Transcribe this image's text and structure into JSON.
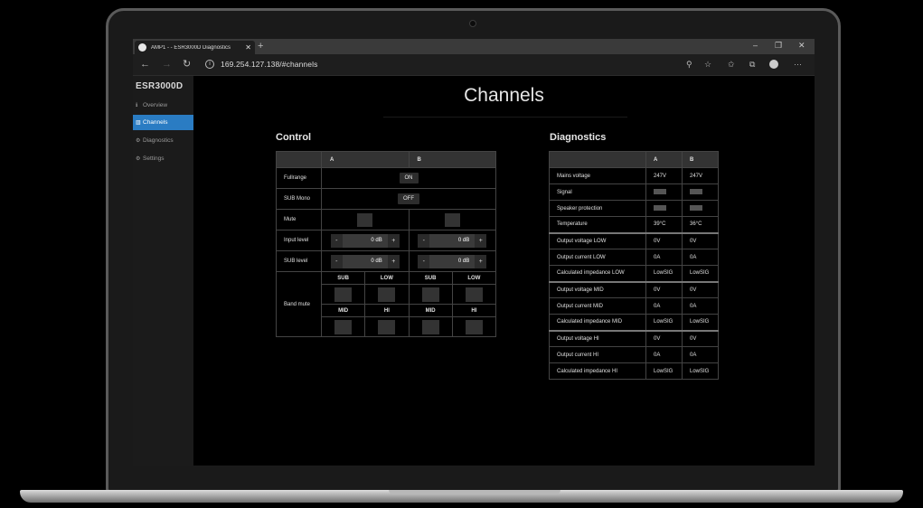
{
  "browser": {
    "tab_title": "AMP1 - - ESR3000D Diagnostics",
    "tab_close": "✕",
    "new_tab": "+",
    "url": "169.254.127.138/#channels",
    "win_minimize": "–",
    "win_restore": "❐",
    "win_close": "✕",
    "back_glyph": "←",
    "forward_glyph": "→",
    "reload_glyph": "↻",
    "info_glyph": "i",
    "zoom_glyph": "⚲",
    "favorite_glyph": "☆",
    "favorites_glyph": "✩",
    "collections_glyph": "⧉",
    "more_glyph": "···"
  },
  "sidebar": {
    "brand": "ESR3000D",
    "items": [
      {
        "icon": "ℹ",
        "label": "Overview"
      },
      {
        "icon": "▥",
        "label": "Channels"
      },
      {
        "icon": "⚙",
        "label": "Diagnostics"
      },
      {
        "icon": "⚙",
        "label": "Settings"
      }
    ]
  },
  "main": {
    "title": "Channels"
  },
  "control": {
    "title": "Control",
    "col_a": "A",
    "col_b": "B",
    "fullrange_label": "Fullrange",
    "fullrange_value": "ON",
    "sub_mono_label": "SUB Mono",
    "sub_mono_value": "OFF",
    "mute_label": "Mute",
    "input_level_label": "Input level",
    "input_level_a": "0 dB",
    "input_level_b": "0 dB",
    "sub_level_label": "SUB level",
    "sub_level_a": "0 dB",
    "sub_level_b": "0 dB",
    "minus": "-",
    "plus": "+",
    "band_mute_label": "Band mute",
    "bands": [
      "SUB",
      "LOW",
      "MID",
      "HI"
    ]
  },
  "diagnostics": {
    "title": "Diagnostics",
    "col_a": "A",
    "col_b": "B",
    "rows": [
      {
        "label": "Mains voltage",
        "a": "247V",
        "b": "247V"
      },
      {
        "label": "Signal",
        "a": "",
        "b": ""
      },
      {
        "label": "Speaker protection",
        "a": "",
        "b": ""
      },
      {
        "label": "Temperature",
        "a": "39°C",
        "b": "36°C"
      },
      {
        "label": "Output voltage LOW",
        "a": "0V",
        "b": "0V"
      },
      {
        "label": "Output current LOW",
        "a": "0A",
        "b": "0A"
      },
      {
        "label": "Calculated impedance LOW",
        "a": "LowSIG",
        "b": "LowSIG"
      },
      {
        "label": "Output voltage MID",
        "a": "0V",
        "b": "0V"
      },
      {
        "label": "Output current MID",
        "a": "0A",
        "b": "0A"
      },
      {
        "label": "Calculated impedance MID",
        "a": "LowSIG",
        "b": "LowSIG"
      },
      {
        "label": "Output voltage HI",
        "a": "0V",
        "b": "0V"
      },
      {
        "label": "Output current HI",
        "a": "0A",
        "b": "0A"
      },
      {
        "label": "Calculated impedance HI",
        "a": "LowSIG",
        "b": "LowSIG"
      }
    ]
  }
}
